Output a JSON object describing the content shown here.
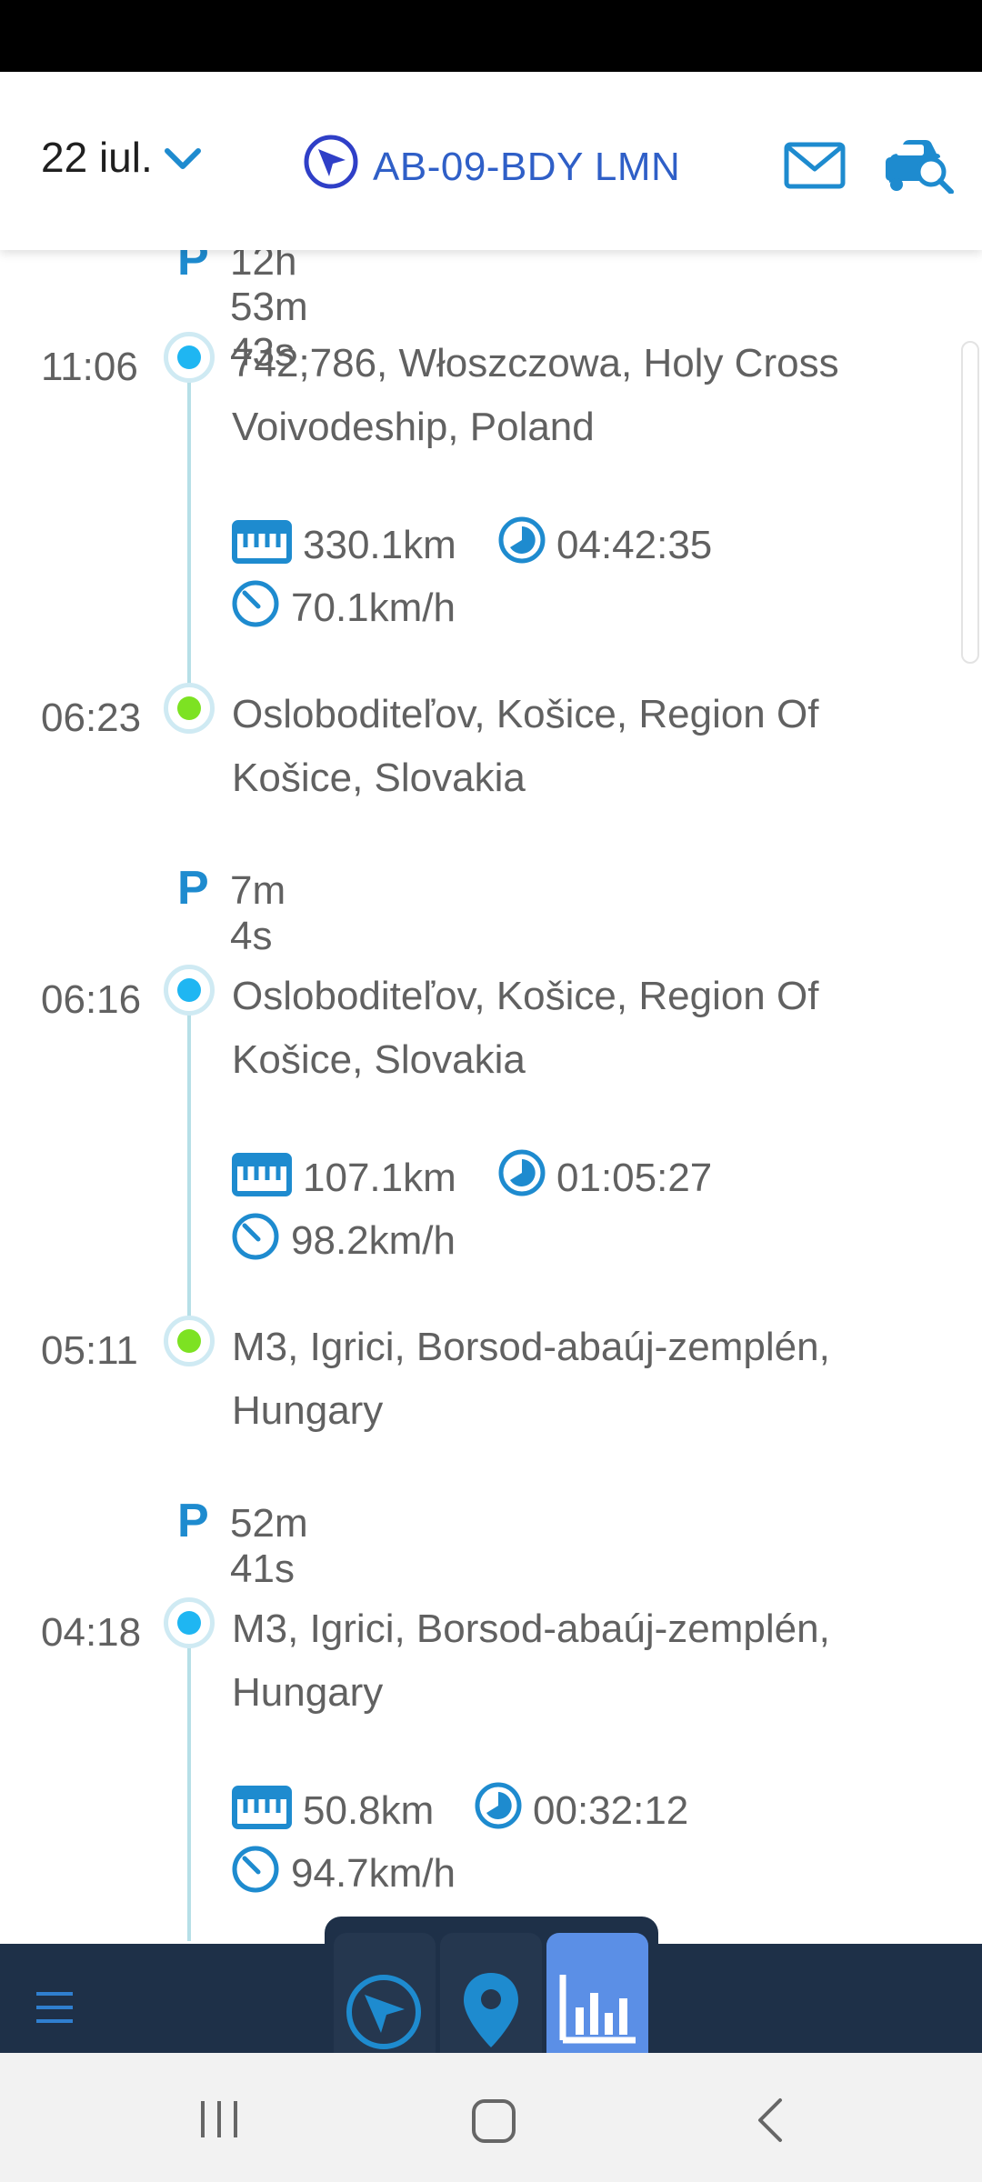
{
  "header": {
    "date": "22 iul.",
    "vehicle": "AB-09-BDY LMN",
    "icons": [
      "chevron-down-icon",
      "navigation-arrow-icon",
      "mail-icon",
      "car-search-icon"
    ]
  },
  "timeline": {
    "parkings": [
      {
        "p": "P",
        "duration": "12h 53m 43s"
      },
      {
        "p": "P",
        "duration": "7m 4s"
      },
      {
        "p": "P",
        "duration": "52m 41s"
      }
    ],
    "trips": [
      {
        "start_time": "11:06",
        "start_address": "742;786, Włoszczowa, Holy Cross Voivodeship, Poland",
        "distance": "330.1km",
        "duration": "04:42:35",
        "avg_speed": "70.1km/h",
        "end_time": "06:23",
        "end_address": "Osloboditeľov, Košice, Region Of Košice, Slovakia"
      },
      {
        "start_time": "06:16",
        "start_address": "Osloboditeľov, Košice, Region Of Košice, Slovakia",
        "distance": "107.1km",
        "duration": "01:05:27",
        "avg_speed": "98.2km/h",
        "end_time": "05:11",
        "end_address": "M3, Igrici, Borsod-abaúj-zemplén, Hungary"
      },
      {
        "start_time": "04:18",
        "start_address": "M3, Igrici, Borsod-abaúj-zemplén, Hungary",
        "distance": "50.8km",
        "duration": "00:32:12",
        "avg_speed": "94.7km/h"
      }
    ]
  },
  "bottom_nav": {
    "icons": [
      "menu-icon",
      "navigation-arrow-icon",
      "map-pin-icon",
      "bar-chart-icon"
    ],
    "active_tab": "reports"
  },
  "colors": {
    "accent": "#1e8bcf",
    "brand_blue": "#2f5fc7",
    "start_dot": "#1fb6f2",
    "end_dot": "#7de222",
    "nav_bg": "#1e3048",
    "active_tab": "#5b8fe6"
  }
}
